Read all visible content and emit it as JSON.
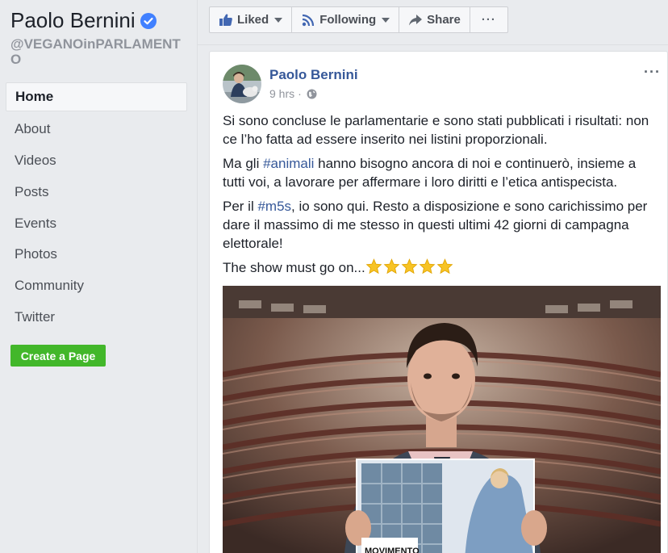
{
  "page": {
    "name": "Paolo Bernini",
    "handle": "@VEGANOinPARLAMENTO"
  },
  "nav": {
    "items": [
      {
        "label": "Home",
        "active": true
      },
      {
        "label": "About"
      },
      {
        "label": "Videos"
      },
      {
        "label": "Posts"
      },
      {
        "label": "Events"
      },
      {
        "label": "Photos"
      },
      {
        "label": "Community"
      },
      {
        "label": "Twitter"
      }
    ],
    "create_page_label": "Create a Page"
  },
  "actions": {
    "liked_label": "Liked",
    "following_label": "Following",
    "share_label": "Share",
    "more_label": "···"
  },
  "post": {
    "author": "Paolo Bernini",
    "time": "9 hrs",
    "separator": "·",
    "paragraph1": "Si sono concluse le parlamentarie e sono stati pubblicati i risultati: non ce l’ho fatta ad essere inserito nei listini proporzionali.",
    "paragraph2_pre": "Ma gli ",
    "paragraph2_tag": "#animali",
    "paragraph2_post": " hanno bisogno ancora di noi e continuerò, insieme a tutti voi, a lavorare per affermare i loro diritti e l’etica antispecista.",
    "paragraph3_pre": "Per il ",
    "paragraph3_tag": "#m5s",
    "paragraph3_post": ", io sono qui. Resto a disposizione e sono carichissimo per dare il massimo di me stesso in questi ultimi 42 giorni di campagna elettorale!",
    "paragraph4": "The show must go on...",
    "star_count": 5,
    "image_caption_text": "MOVIMENTO"
  },
  "colors": {
    "brand_blue": "#365899",
    "green": "#42b72a",
    "star": "#f7c325",
    "verified": "#4080ff"
  }
}
